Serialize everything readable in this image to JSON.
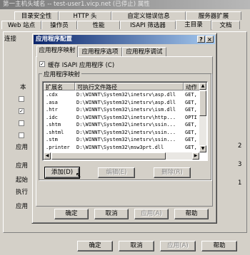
{
  "outer_window": {
    "title": "第一主机头域名 -- test-user1.vicp.net (已停止) 属性",
    "tabs_row1": [
      "目录安全性",
      "HTTP 头",
      "自定义错误信息",
      "服务器扩展"
    ],
    "tabs_row2": [
      "Web 站点",
      "操作员",
      "性能",
      "ISAPI 筛选器",
      "主目录",
      "文档"
    ],
    "left_fragments": [
      "连接",
      "本",
      "应用",
      "应用",
      "起始",
      "执行",
      "应用"
    ],
    "inner_buttons": [
      "确定",
      "取消",
      "应用(A)",
      "帮助"
    ],
    "bottom_buttons": [
      "确定",
      "取消",
      "应用(A)",
      "帮助"
    ],
    "right_fragments": [
      "2",
      "3",
      "1"
    ]
  },
  "dialog": {
    "title": "应用程序配置",
    "help_glyph": "?",
    "close_glyph": "×",
    "tabs": [
      "应用程序映射",
      "应用程序选项",
      "应用程序调试"
    ],
    "cache_label": "缓存 ISAPI 应用程序 (C)",
    "group_label": "应用程序映射",
    "columns": [
      "扩展名",
      "可执行文件路径",
      "动作"
    ],
    "rows": [
      {
        "ext": ".cdx",
        "path": "D:\\WINNT\\System32\\inetsrv\\asp.dll",
        "verbs": "GET,"
      },
      {
        "ext": ".asa",
        "path": "D:\\WINNT\\System32\\inetsrv\\asp.dll",
        "verbs": "GET,"
      },
      {
        "ext": ".htr",
        "path": "D:\\WINNT\\System32\\inetsrv\\ism.dll",
        "verbs": "GET,"
      },
      {
        "ext": ".idc",
        "path": "D:\\WINNT\\System32\\inetsrv\\http...",
        "verbs": "OPTI"
      },
      {
        "ext": ".shtm",
        "path": "D:\\WINNT\\System32\\inetsrv\\ssin...",
        "verbs": "GET,"
      },
      {
        "ext": ".shtml",
        "path": "D:\\WINNT\\System32\\inetsrv\\ssin...",
        "verbs": "GET,"
      },
      {
        "ext": ".stm",
        "path": "D:\\WINNT\\System32\\inetsrv\\ssin...",
        "verbs": "GET,"
      },
      {
        "ext": ".printer",
        "path": "D:\\WINNT\\System32\\msw3prt.dll",
        "verbs": "GET,"
      }
    ],
    "add_button": "添加(D)",
    "edit_button": "编辑(E)",
    "remove_button": "删除(R)"
  }
}
